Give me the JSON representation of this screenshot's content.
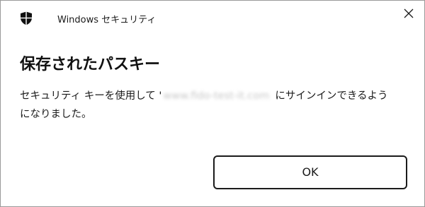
{
  "titlebar": {
    "app_name": "Windows セキュリティ",
    "icon": "shield-icon",
    "close_icon": "close-icon"
  },
  "dialog": {
    "heading": "保存されたパスキー",
    "message_prefix": "セキュリティ キーを使用して '",
    "message_site": "www.fido-test-it.com",
    "message_suffix_line1": "にサインインできるよう",
    "message_suffix_line2": "になりました。"
  },
  "buttons": {
    "ok_label": "OK"
  },
  "colors": {
    "border": "#9a9a9a",
    "button_border": "#1b1b1b",
    "text": "#1a1a1a"
  }
}
